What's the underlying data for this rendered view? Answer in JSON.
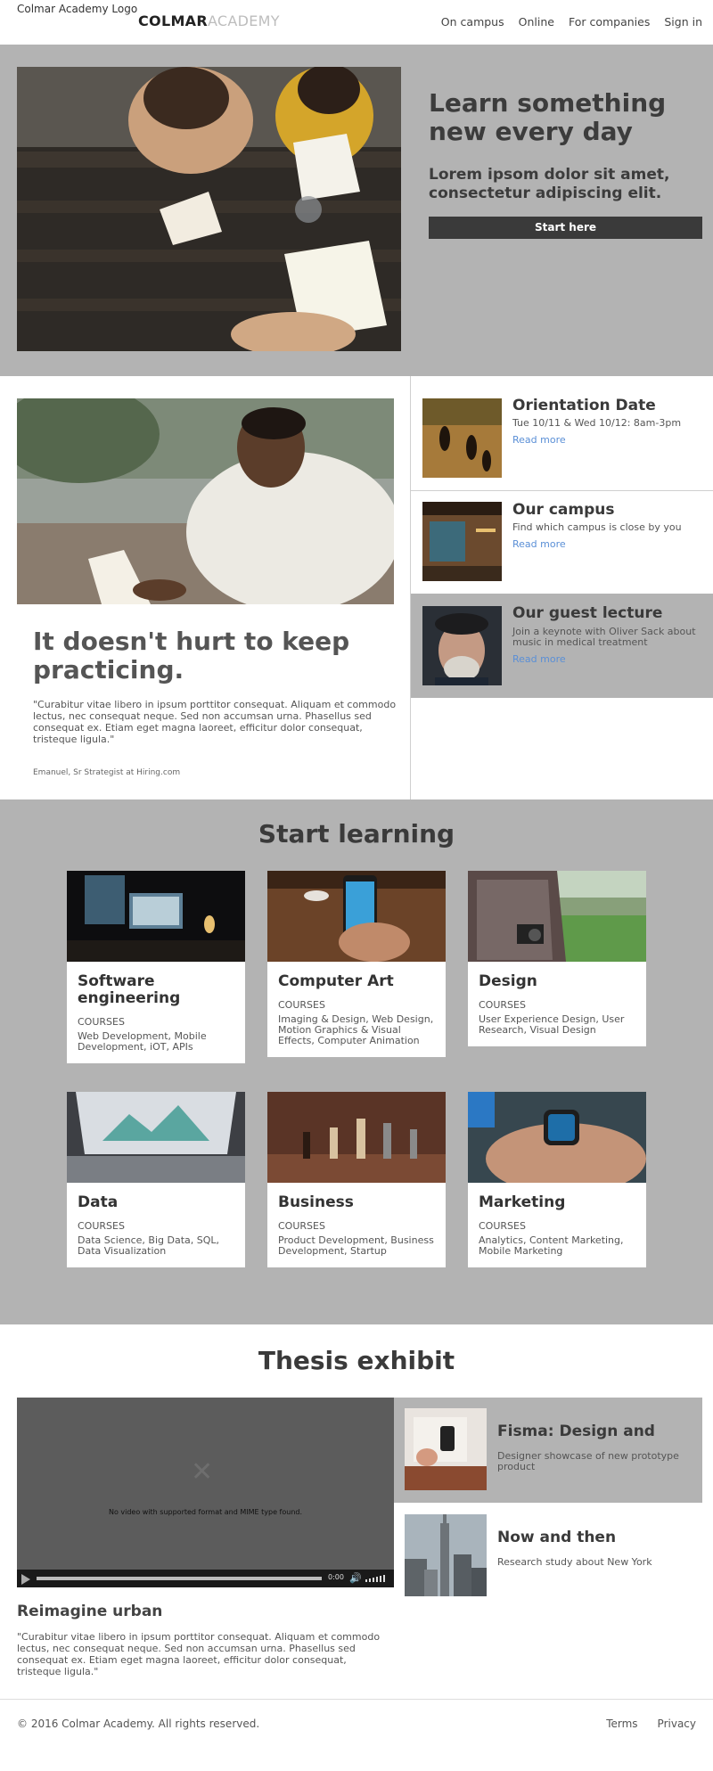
{
  "header": {
    "logo_alt": "Colmar Academy Logo",
    "logo_strong": "COLMAR",
    "logo_light": "ACADEMY",
    "nav": [
      "On campus",
      "Online",
      "For companies",
      "Sign in"
    ]
  },
  "hero": {
    "title": "Learn something new every day",
    "subtitle": "Lorem ipsom dolor sit amet, consectetur adipiscing elit.",
    "button": "Start here"
  },
  "feature": {
    "title": "It doesn't hurt to keep practicing.",
    "quote": "\"Curabitur vitae libero in ipsum porttitor consequat. Aliquam et commodo lectus, nec consequat neque. Sed non accumsan urna. Phasellus sed consequat ex. Etiam eget magna laoreet, efficitur dolor consequat, tristeque ligula.\"",
    "cite": "Emanuel, Sr Strategist at Hiring.com"
  },
  "events": [
    {
      "title": "Orientation Date",
      "desc": "Tue 10/11 & Wed 10/12: 8am-3pm",
      "link": "Read more"
    },
    {
      "title": "Our campus",
      "desc": "Find which campus is close by you",
      "link": "Read more"
    },
    {
      "title": "Our guest lecture",
      "desc": "Join a keynote with Oliver Sack about music in medical treatment",
      "link": "Read more"
    }
  ],
  "learning": {
    "title": "Start learning",
    "courses": [
      {
        "title": "Software engineering",
        "label": "COURSES",
        "desc": "Web Development, Mobile Development, iOT, APIs"
      },
      {
        "title": "Computer Art",
        "label": "COURSES",
        "desc": "Imaging & Design, Web Design, Motion Graphics & Visual Effects, Computer Animation"
      },
      {
        "title": "Design",
        "label": "COURSES",
        "desc": "User Experience Design, User Research, Visual Design"
      },
      {
        "title": "Data",
        "label": "COURSES",
        "desc": "Data Science, Big Data, SQL, Data Visualization"
      },
      {
        "title": "Business",
        "label": "COURSES",
        "desc": "Product Development, Business Development, Startup"
      },
      {
        "title": "Marketing",
        "label": "COURSES",
        "desc": "Analytics, Content Marketing, Mobile Marketing"
      }
    ]
  },
  "thesis": {
    "title": "Thesis exhibit",
    "video_message": "No video with supported format and MIME type found.",
    "video_time": "0:00",
    "heading": "Reimagine urban",
    "quote": "\"Curabitur vitae libero in ipsum porttitor consequat. Aliquam et commodo lectus, nec consequat neque. Sed non accumsan urna. Phasellus sed consequat ex. Etiam eget magna laoreet, efficitur dolor consequat, tristeque ligula.\"",
    "projects": [
      {
        "title": "Fisma: Design and",
        "desc": "Designer showcase of new prototype product"
      },
      {
        "title": "Now and then",
        "desc": "Research study about New York"
      }
    ]
  },
  "footer": {
    "copyright": "© 2016 Colmar Academy. All rights reserved.",
    "links": [
      "Terms",
      "Privacy"
    ]
  },
  "colors": {
    "grey_band": "#b3b3b3",
    "button_dark": "#3a3a3a",
    "link_blue": "#5a8fd6"
  }
}
